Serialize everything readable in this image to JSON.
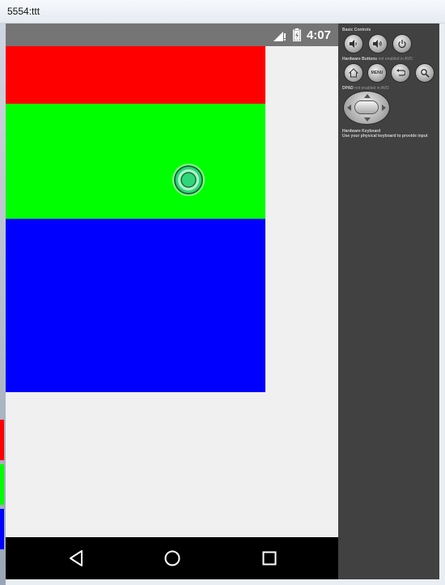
{
  "window": {
    "title": "5554:ttt"
  },
  "status_bar": {
    "time": "4:07",
    "signal_icon": "signal-no-data-icon",
    "battery_icon": "battery-charging-icon"
  },
  "app": {
    "blocks": [
      {
        "name": "red",
        "color": "#ff0000"
      },
      {
        "name": "green",
        "color": "#00ff00"
      },
      {
        "name": "blue",
        "color": "#0000ff"
      }
    ],
    "background": "#f0f0f0"
  },
  "nav_bar": {
    "back_icon": "back-triangle-icon",
    "home_icon": "home-circle-icon",
    "recents_icon": "recents-square-icon"
  },
  "controls_panel": {
    "basic_controls_label": "Basic Controls",
    "hardware_buttons_label": "Hardware Buttons",
    "hardware_buttons_note": "not enabled in AVD",
    "menu_label": "MENU",
    "dpad_label": "DPAD",
    "dpad_note": "not enabled in AVD",
    "keyboard_label": "Hardware Keyboard",
    "keyboard_note": "Use your physical keyboard to provide input"
  },
  "colors": {
    "panel_bg": "#414141",
    "status_bar_bg": "#757575",
    "touch_indicator": "#2fd67a"
  }
}
